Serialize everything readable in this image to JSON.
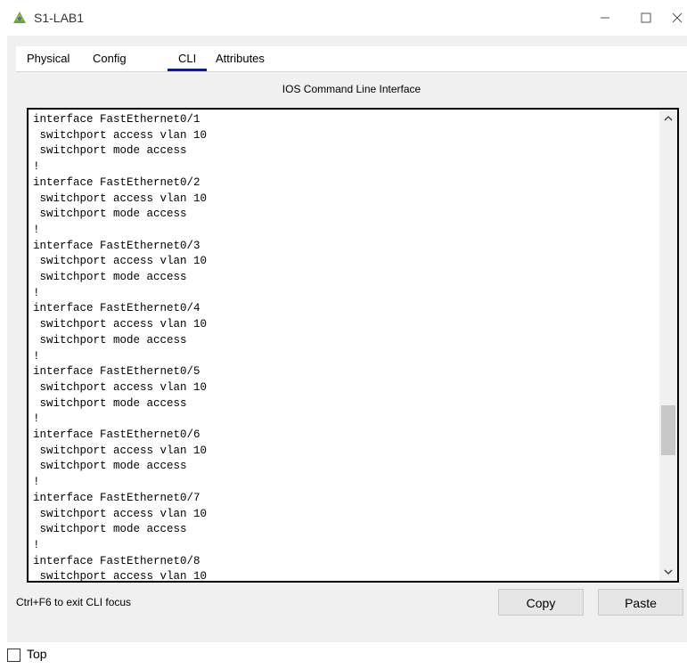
{
  "window": {
    "title": "S1-LAB1",
    "icon": "packet-tracer-switch-icon",
    "controls": {
      "minimize": "minimize-icon",
      "maximize": "maximize-icon",
      "close": "close-icon"
    }
  },
  "tabs": [
    {
      "label": "Physical",
      "active": false
    },
    {
      "label": "Config",
      "active": false
    },
    {
      "label": "CLI",
      "active": true
    },
    {
      "label": "Attributes",
      "active": false
    }
  ],
  "cli": {
    "heading": "IOS Command Line Interface",
    "output": "interface FastEthernet0/1\n switchport access vlan 10\n switchport mode access\n!\ninterface FastEthernet0/2\n switchport access vlan 10\n switchport mode access\n!\ninterface FastEthernet0/3\n switchport access vlan 10\n switchport mode access\n!\ninterface FastEthernet0/4\n switchport access vlan 10\n switchport mode access\n!\ninterface FastEthernet0/5\n switchport access vlan 10\n switchport mode access\n!\ninterface FastEthernet0/6\n switchport access vlan 10\n switchport mode access\n!\ninterface FastEthernet0/7\n switchport access vlan 10\n switchport mode access\n!\ninterface FastEthernet0/8\n switchport access vlan 10",
    "focus_hint": "Ctrl+F6 to exit CLI focus",
    "copy_label": "Copy",
    "paste_label": "Paste",
    "scroll_position": 0.72
  },
  "bottom": {
    "top_checkbox_label": "Top",
    "top_checked": false
  }
}
